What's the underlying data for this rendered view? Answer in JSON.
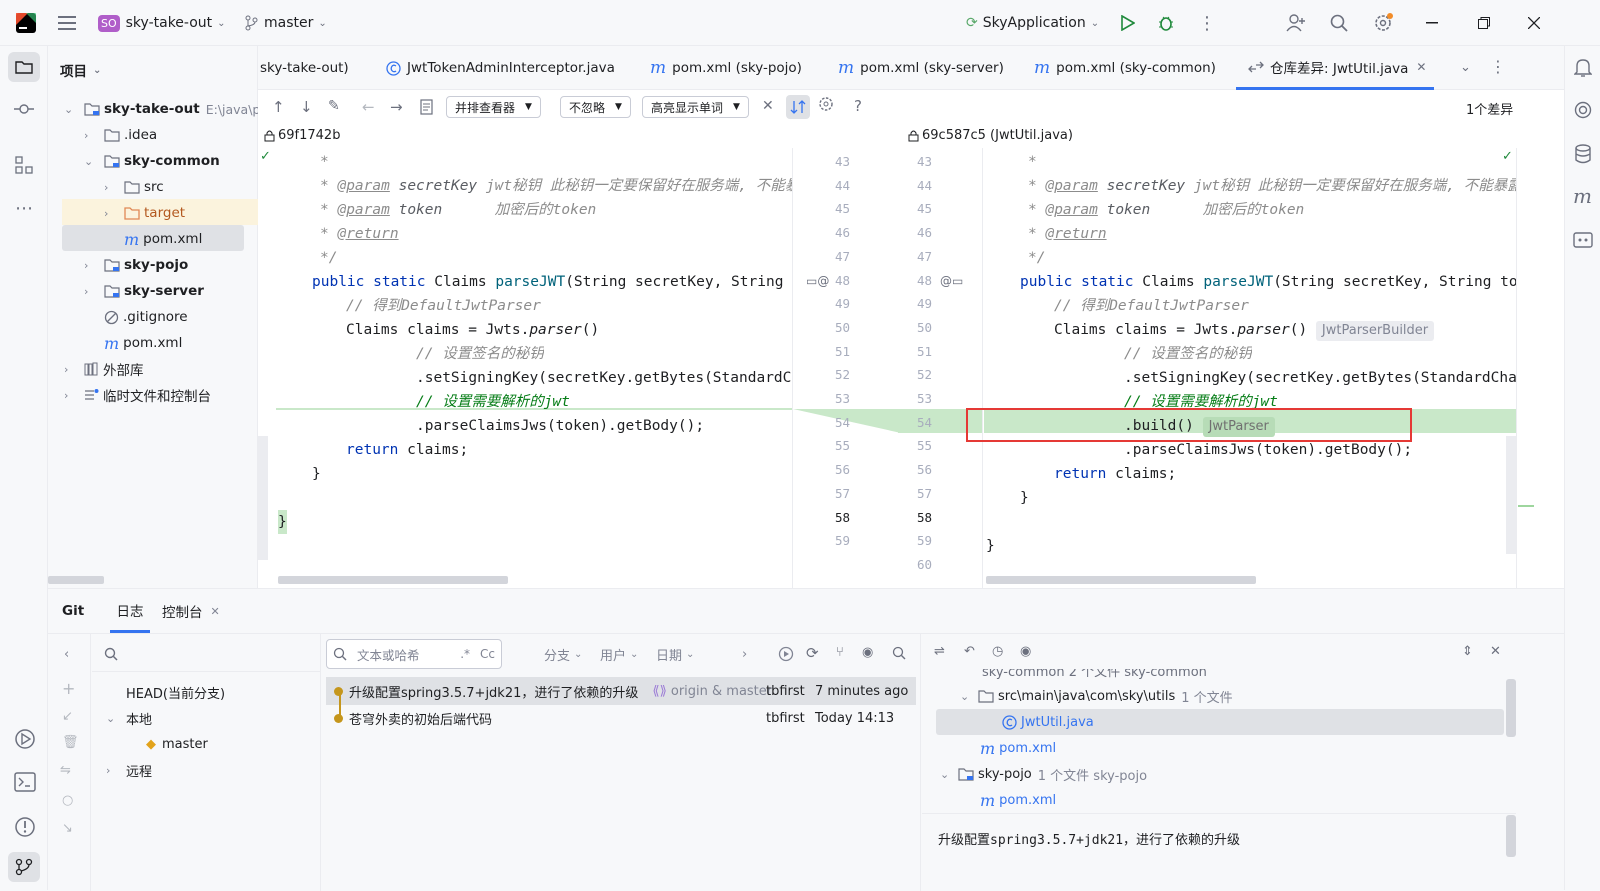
{
  "titlebar": {
    "app_logo": "intellij-logo",
    "project_badge": "SO",
    "project_name": "sky-take-out",
    "branch": "master",
    "run_config": "SkyApplication"
  },
  "project_panel": {
    "title": "项目",
    "root_name": "sky-take-out",
    "root_path": "E:\\java\\prc",
    "items": [
      {
        "label": "sky-take-out"
      },
      {
        "label": ".idea"
      },
      {
        "label": "sky-common"
      },
      {
        "label": "src"
      },
      {
        "label": "target"
      },
      {
        "label": "pom.xml"
      },
      {
        "label": "sky-pojo"
      },
      {
        "label": "sky-server"
      },
      {
        "label": ".gitignore"
      },
      {
        "label": "pom.xml"
      },
      {
        "label": "外部库"
      },
      {
        "label": "临时文件和控制台"
      }
    ]
  },
  "tabs": [
    {
      "label": "sky-take-out)"
    },
    {
      "label": "JwtTokenAdminInterceptor.java"
    },
    {
      "label": "pom.xml (sky-pojo)"
    },
    {
      "label": "pom.xml (sky-server)"
    },
    {
      "label": "pom.xml (sky-common)"
    },
    {
      "label": "仓库差异: JwtUtil.java"
    }
  ],
  "diff_toolbar": {
    "viewer": "并排查看器",
    "ignore": "不忽略",
    "highlight": "高亮显示单词",
    "diff_count": "1个差异"
  },
  "diff": {
    "left_rev": "69f1742b",
    "right_rev": "69c587c5 (JwtUtil.java)",
    "left_lines": [
      "43",
      "44",
      "45",
      "46",
      "47",
      "48",
      "49",
      "50",
      "51",
      "52",
      "53",
      "54",
      "55",
      "56",
      "57",
      "58",
      "59"
    ],
    "right_lines": [
      "43",
      "44",
      "45",
      "46",
      "47",
      "48",
      "49",
      "50",
      "51",
      "52",
      "53",
      "54",
      "55",
      "56",
      "57",
      "58",
      "59",
      "60"
    ],
    "hint_parser_builder": "JwtParserBuilder",
    "hint_jwt_parser": "JwtParser",
    "code": {
      "c_star": "*",
      "param1_tag": "@param",
      "param1_name": " secretKey ",
      "param1_desc": "jwt秘钥 此秘钥一定要保留好在服务端, 不能暴露",
      "param2_tag": "@param",
      "param2_name": " token",
      "param2_desc": "加密后的token",
      "return_tag": "@return",
      "end_comment": "*/",
      "sig_kw": "public static",
      "sig_type": " Claims ",
      "sig_fn": "parseJWT",
      "sig_rest_left": "(String secretKey, String t",
      "sig_rest_right": "(String secretKey, String tok",
      "comment1": "// 得到DefaultJwtParser",
      "claims_line": "Claims claims = Jwts.",
      "parser_call": "parser",
      "parser_paren": "()",
      "comment2": "// 设置签名的秘钥",
      "signing_left": ".setSigningKey(secretKey.getBytes(StandardCh",
      "signing_right": ".setSigningKey(secretKey.getBytes(StandardChar",
      "comment3": "// 设置需要解析的jwt",
      "build_call": ".build()",
      "parse_call": ".parseClaimsJws(token).getBody();",
      "return_kw": "return",
      "return_rest": " claims;",
      "close_brace": "}"
    }
  },
  "bottom": {
    "tabs": [
      {
        "label": "Git"
      },
      {
        "label": "日志"
      },
      {
        "label": "控制台"
      }
    ],
    "branch_search_placeholder": "",
    "branches": {
      "head": "HEAD(当前分支)",
      "local": "本地",
      "master": "master",
      "remote": "远程"
    },
    "log_search_placeholder": "文本或哈希",
    "filters": [
      "分支",
      "用户",
      "日期"
    ],
    "commits": [
      {
        "message": "升级配置spring3.5.7+jdk21，进行了依赖的升级",
        "refs": "origin & master",
        "author": "tbfirst",
        "date": "7 minutes ago"
      },
      {
        "message": "苍穹外卖的初始后端代码",
        "refs": "",
        "author": "tbfirst",
        "date": "Today 14:13"
      }
    ],
    "changes": {
      "partial_header": "sky-common  2 个文件  sky-common",
      "utils_dir": "src\\main\\java\\com\\sky\\utils",
      "utils_count": "1 个文件",
      "jwtutil_file": "JwtUtil.java",
      "pom_file": "pom.xml",
      "pojo_module": "sky-pojo",
      "pojo_count": "1 个文件  sky-pojo",
      "pojo_pom": "pom.xml"
    },
    "commit_detail": "升级配置spring3.5.7+jdk21，进行了依赖的升级"
  },
  "colors": {
    "accent": "#3574f0",
    "inserted": "#c9e8c9",
    "highlight_box": "#e53935"
  }
}
